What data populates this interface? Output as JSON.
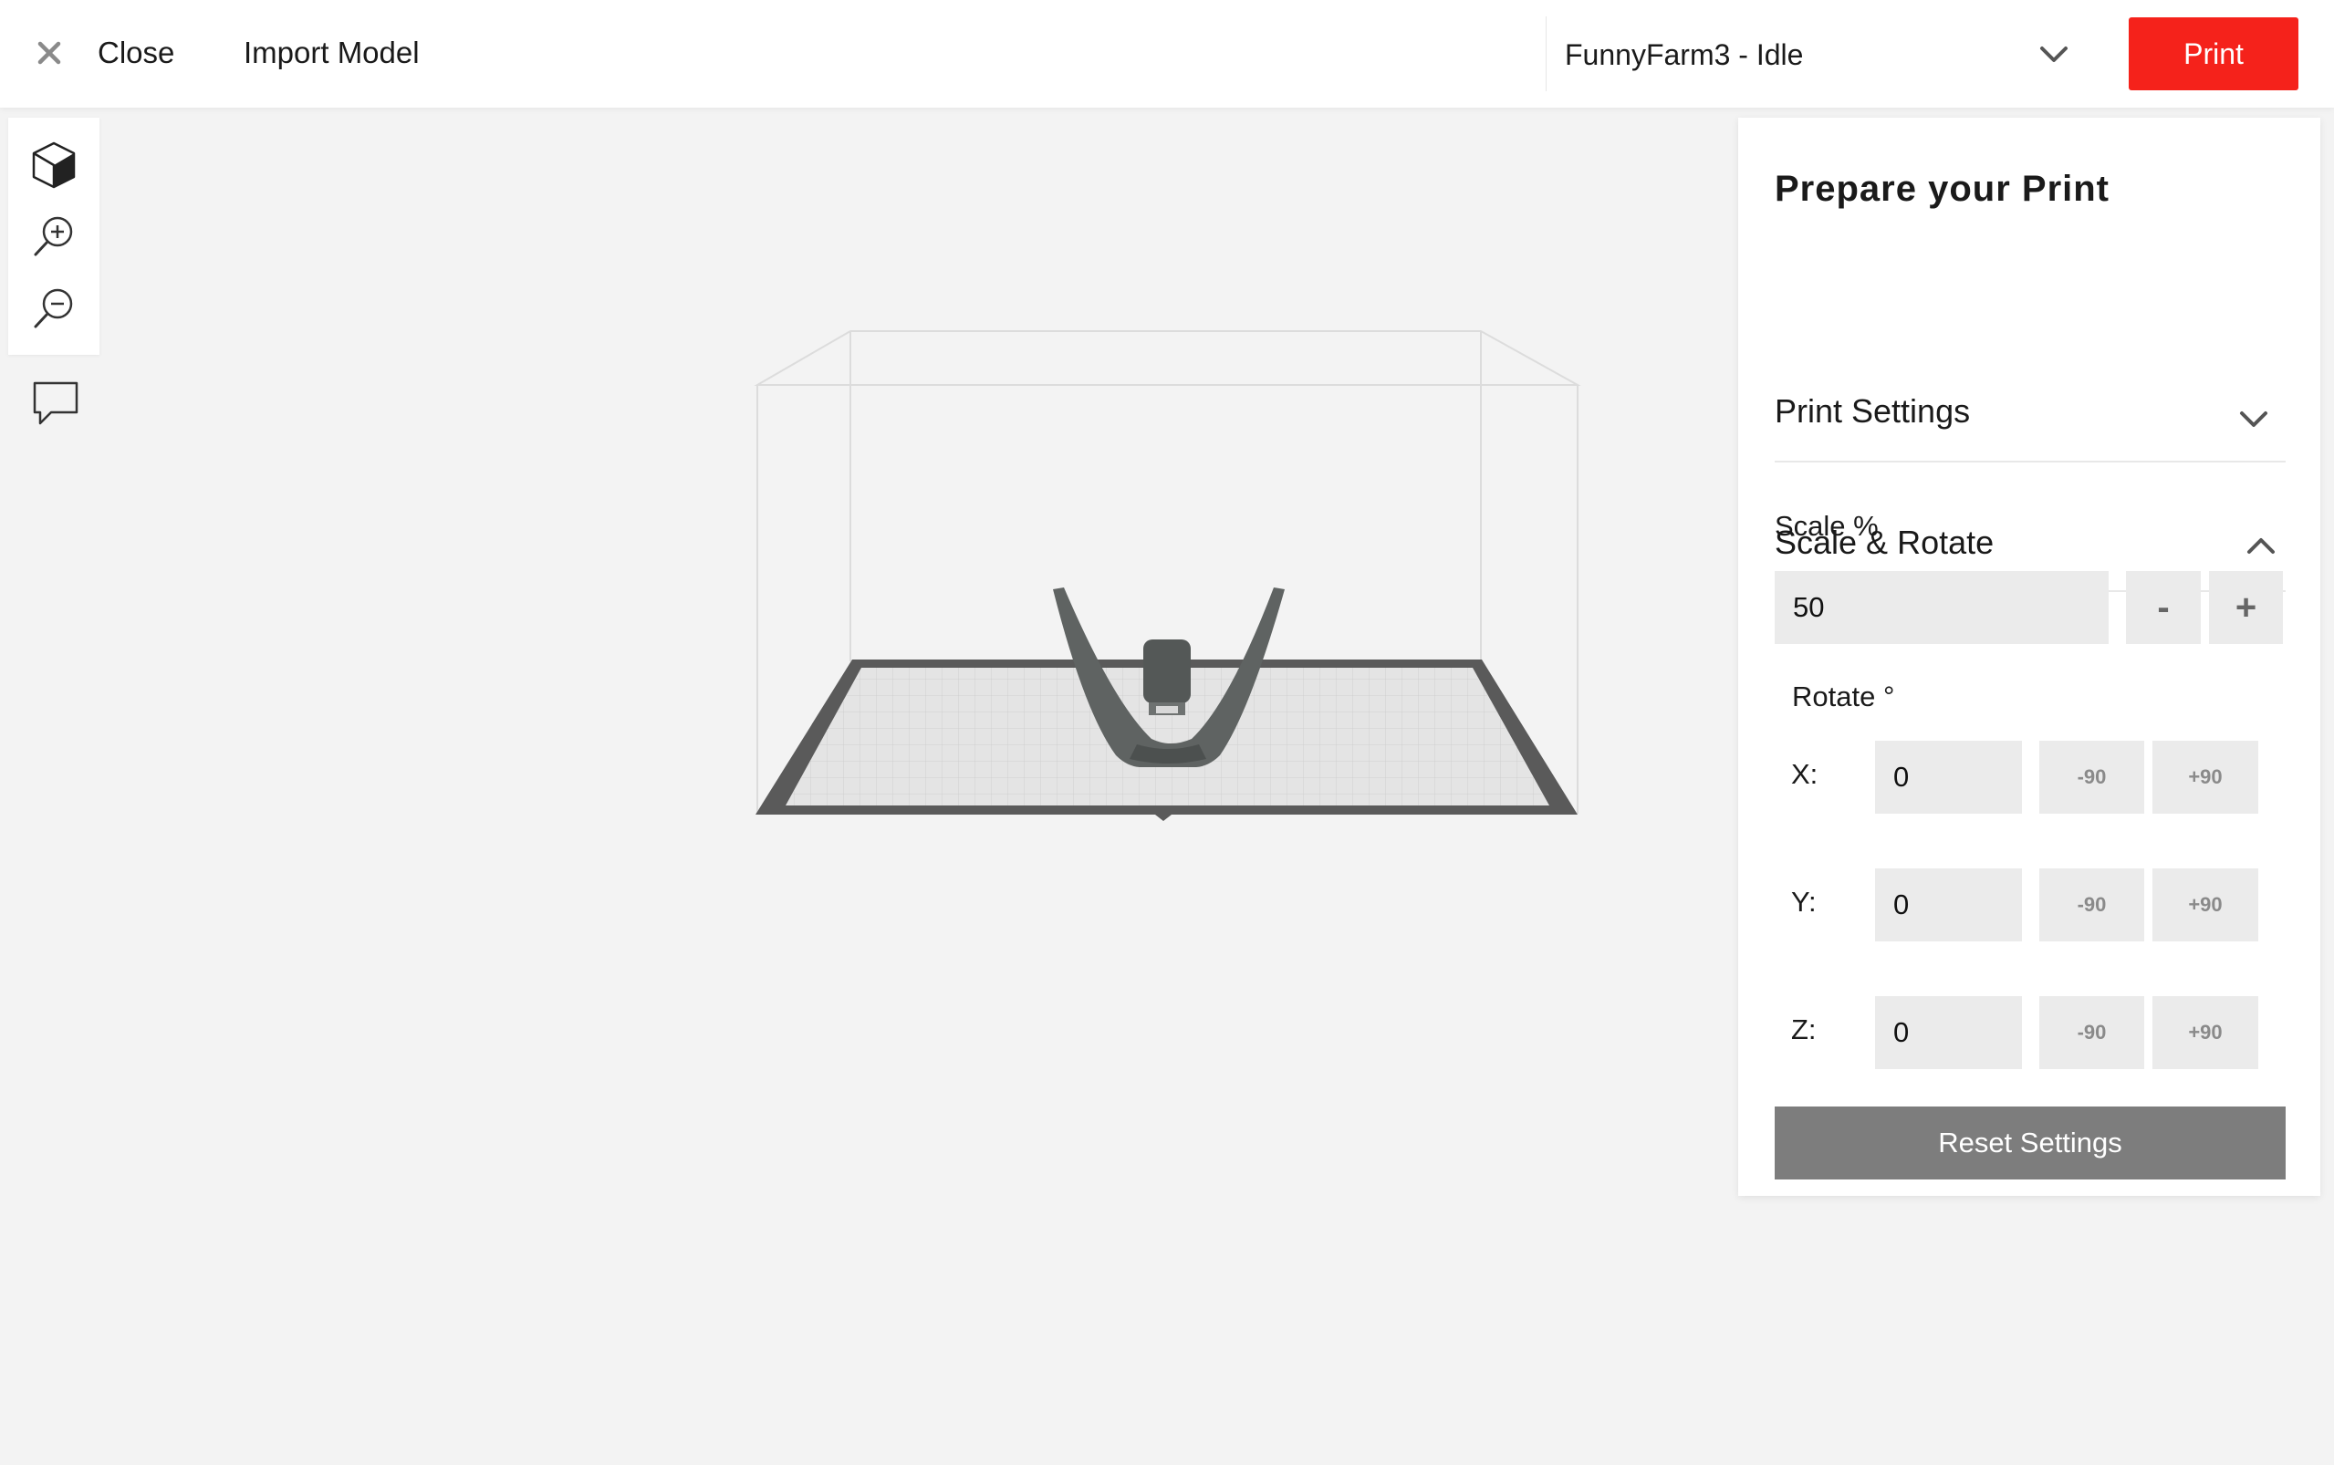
{
  "topbar": {
    "close_label": "Close",
    "import_label": "Import Model",
    "printer_status": "FunnyFarm3 - Idle",
    "print_label": "Print",
    "accent_color": "#f5221b"
  },
  "tools": {
    "icons": [
      "cube-view-icon",
      "zoom-in-icon",
      "zoom-out-icon",
      "chat-icon"
    ]
  },
  "panel": {
    "title": "Prepare your Print",
    "print_settings": "Print Settings",
    "scale_rotate": "Scale & Rotate",
    "scale_label": "Scale %",
    "scale_value": "50",
    "minus_label": "-",
    "plus_label": "+",
    "rotate_label": "Rotate °",
    "axes": [
      {
        "label": "X:",
        "value": "0",
        "minus": "-90",
        "plus": "+90"
      },
      {
        "label": "Y:",
        "value": "0",
        "minus": "-90",
        "plus": "+90"
      },
      {
        "label": "Z:",
        "value": "0",
        "minus": "-90",
        "plus": "+90"
      }
    ],
    "reset_label": "Reset Settings"
  }
}
